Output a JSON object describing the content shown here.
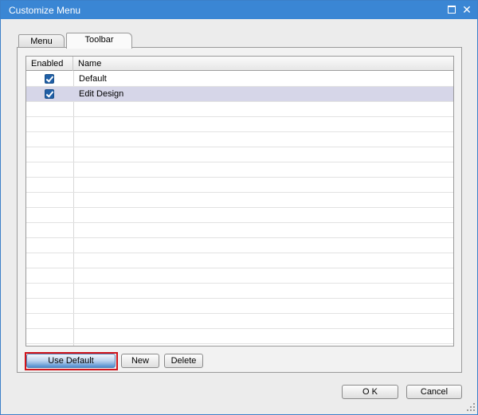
{
  "window": {
    "title": "Customize Menu",
    "accent_color": "#3a86d4"
  },
  "tabs": [
    {
      "label": "Menu",
      "selected": false
    },
    {
      "label": "Toolbar",
      "selected": true
    }
  ],
  "grid": {
    "columns": [
      "Enabled",
      "Name"
    ],
    "rows": [
      {
        "enabled": true,
        "name": "Default",
        "selected": false
      },
      {
        "enabled": true,
        "name": "Edit Design",
        "selected": true
      }
    ],
    "selection_color": "#d6d6e8"
  },
  "buttons": {
    "use_default": "Use Default",
    "new": "New",
    "delete": "Delete",
    "ok": "O K",
    "cancel": "Cancel"
  },
  "highlight_color": "#d0141b"
}
